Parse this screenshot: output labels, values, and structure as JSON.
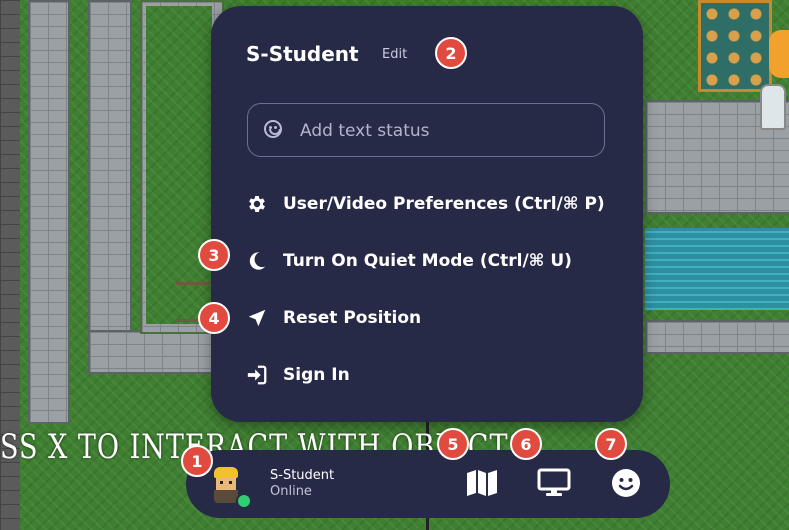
{
  "world": {
    "interaction_hint": "SS X TO INTERACT WITH OBJECTS"
  },
  "menu": {
    "title": "S-Student",
    "edit_label": "Edit",
    "status_placeholder": "Add text status",
    "items": [
      {
        "icon": "gear-icon",
        "label": "User/Video Preferences (Ctrl/⌘ P)"
      },
      {
        "icon": "moon-icon",
        "label": "Turn On Quiet Mode (Ctrl/⌘ U)"
      },
      {
        "icon": "navigation-arrow-icon",
        "label": "Reset Position"
      },
      {
        "icon": "sign-in-icon",
        "label": "Sign In"
      }
    ]
  },
  "user": {
    "name": "S-Student",
    "status": "Online"
  },
  "bottom_bar": {
    "buttons": [
      {
        "icon": "map-icon"
      },
      {
        "icon": "screen-share-icon"
      },
      {
        "icon": "emoji-icon"
      }
    ]
  },
  "badges": [
    "1",
    "2",
    "3",
    "4",
    "5",
    "6",
    "7"
  ],
  "colors": {
    "panel": "#272a47",
    "badge": "#e14a3e",
    "online": "#2fcf72"
  }
}
